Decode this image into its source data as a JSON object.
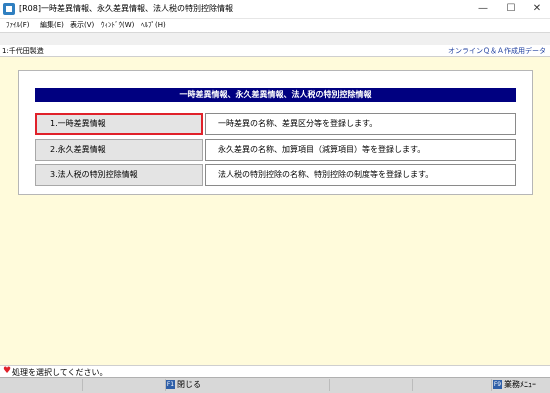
{
  "window": {
    "title": "[R08]一時差異情報、永久差異情報、法人税の特別控除情報",
    "controls": {
      "minimize": "—",
      "maximize": "☐",
      "close": "✕"
    }
  },
  "menu": [
    "ﾌｧｲﾙ(F)",
    "編集(E)",
    "表示(V)",
    "ｳｨﾝﾄﾞｳ(W)",
    "ﾍﾙﾌﾟ(H)"
  ],
  "infobar": {
    "company": "1:千代田製造",
    "right": "オンラインＱ＆Ａ作成用データ"
  },
  "panel": {
    "header": "一時差異情報、永久差異情報、法人税の特別控除情報",
    "rows": [
      {
        "button": "1.一時差異情報",
        "description": "一時差異の名称、差異区分等を登録します。",
        "selected": true
      },
      {
        "button": "2.永久差異情報",
        "description": "永久差異の名称、加算項目（減算項目）等を登録します。",
        "selected": false
      },
      {
        "button": "3.法人税の特別控除情報",
        "description": "法人税の特別控除の名称、特別控除の制度等を登録します。",
        "selected": false
      }
    ]
  },
  "status": {
    "message": "処理を選択してください。"
  },
  "fkeys": {
    "close": {
      "key": "F1",
      "label": "閉じる"
    },
    "menu": {
      "key": "F9",
      "label": "業務ﾒﾆｭｰ"
    }
  }
}
